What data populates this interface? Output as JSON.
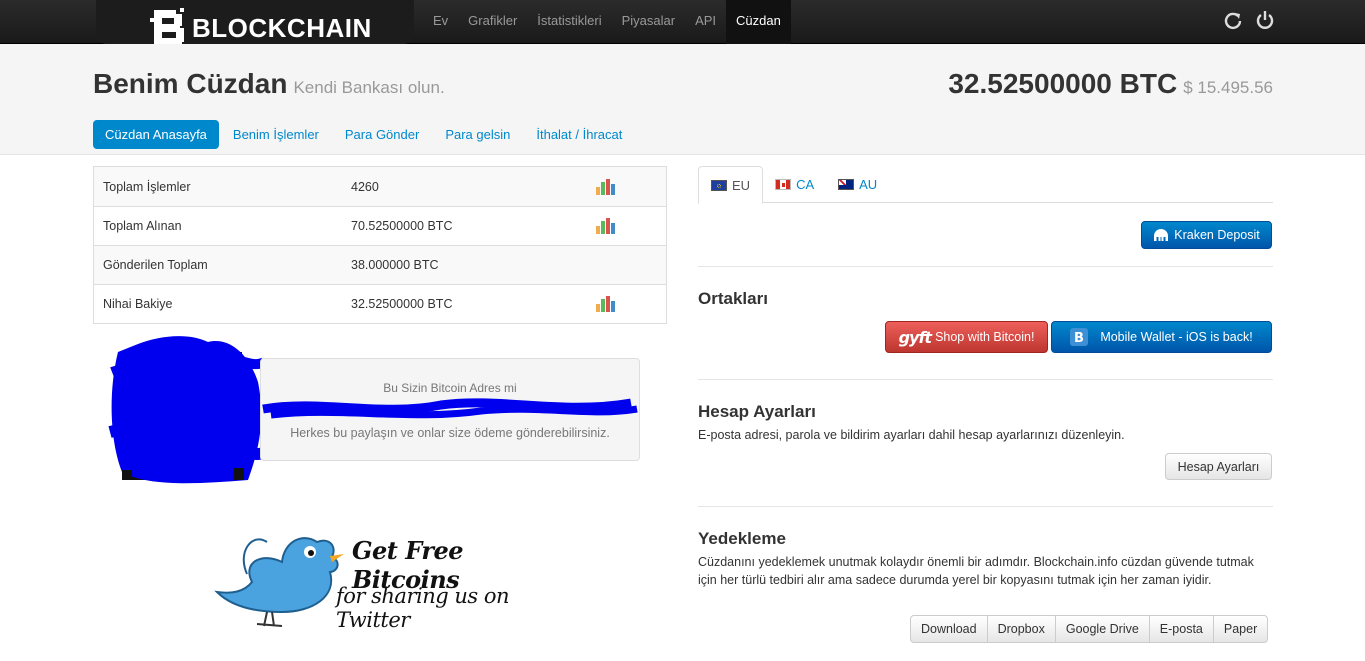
{
  "brand": {
    "name": "BLOCKCHAIN"
  },
  "nav": {
    "items": [
      {
        "label": "Ev",
        "active": false
      },
      {
        "label": "Grafikler",
        "active": false
      },
      {
        "label": "İstatistikleri",
        "active": false
      },
      {
        "label": "Piyasalar",
        "active": false
      },
      {
        "label": "API",
        "active": false
      },
      {
        "label": "Cüzdan",
        "active": true
      }
    ],
    "icons": [
      "refresh-icon",
      "power-icon"
    ]
  },
  "header": {
    "title": "Benim Cüzdan",
    "subtitle": "Kendi Bankası olun.",
    "balance_btc": "32.52500000 BTC",
    "balance_usd": "$ 15.495.56"
  },
  "subnav": {
    "items": [
      {
        "label": "Cüzdan Anasayfa",
        "active": true
      },
      {
        "label": "Benim İşlemler",
        "active": false
      },
      {
        "label": "Para Gönder",
        "active": false
      },
      {
        "label": "Para gelsin",
        "active": false
      },
      {
        "label": "İthalat / İhracat",
        "active": false
      }
    ]
  },
  "stats": {
    "rows": [
      {
        "label": "Toplam İşlemler",
        "value": "4260",
        "chart": true
      },
      {
        "label": "Toplam Alınan",
        "value": "70.52500000 BTC",
        "chart": true
      },
      {
        "label": "Gönderilen Toplam",
        "value": "38.000000 BTC",
        "chart": false
      },
      {
        "label": "Nihai Bakiye",
        "value": "32.52500000 BTC",
        "chart": true
      }
    ]
  },
  "address": {
    "title": "Bu Sizin Bitcoin Adres mi",
    "help": "Herkes bu paylaşın ve onlar size ödeme gönderebilirsiniz."
  },
  "promo": {
    "line1": "Get Free Bitcoins",
    "line2": "for sharing us on Twitter"
  },
  "regions": {
    "tabs": [
      {
        "label": "EU",
        "active": true
      },
      {
        "label": "CA",
        "active": false
      },
      {
        "label": "AU",
        "active": false
      }
    ],
    "deposit_label": "Kraken Deposit"
  },
  "partners": {
    "title": "Ortakları",
    "gyft_logo": "gyft",
    "gyft_label": "Shop with Bitcoin!",
    "mobile_label": "Mobile Wallet - iOS is back!"
  },
  "account": {
    "title": "Hesap Ayarları",
    "text": "E-posta adresi, parola ve bildirim ayarları dahil hesap ayarlarınızı düzenleyin.",
    "button": "Hesap Ayarları"
  },
  "backup": {
    "title": "Yedekleme",
    "text": "Cüzdanını yedeklemek unutmak kolaydır önemli bir adımdır. Blockchain.info cüzdan güvende tutmak için her türlü tedbiri alır ama sadece durumda yerel bir kopyasını tutmak için her zaman iyidir.",
    "buttons": [
      "Download",
      "Dropbox",
      "Google Drive",
      "E-posta",
      "Paper"
    ]
  },
  "colors": {
    "accent": "#0088cc",
    "danger": "#da4f49",
    "navbar": "#1f1f1f",
    "scribble": "#0000ee"
  }
}
